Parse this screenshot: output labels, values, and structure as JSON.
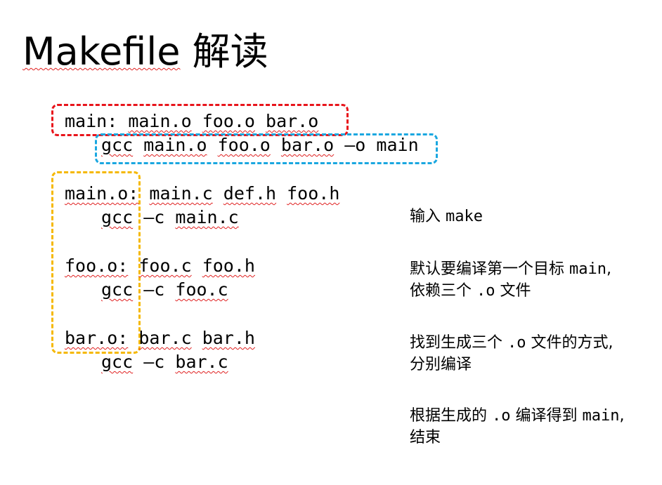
{
  "title": {
    "word": "Makefile",
    "suffix": " 解读"
  },
  "code": {
    "rule1_target": "main:",
    "rule1_deps": [
      "main.o",
      "foo.o",
      "bar.o"
    ],
    "rule1_cmd": [
      "gcc",
      "main.o",
      "foo.o",
      "bar.o",
      "–o",
      "main"
    ],
    "rule2_target": "main.o:",
    "rule2_deps": [
      "main.c",
      "def.h",
      "foo.h"
    ],
    "rule2_cmd": [
      "gcc",
      "–c",
      "main.c"
    ],
    "rule3_target": "foo.o:",
    "rule3_deps": [
      "foo.c",
      "foo.h"
    ],
    "rule3_cmd": [
      "gcc",
      "–c",
      "foo.c"
    ],
    "rule4_target": "bar.o:",
    "rule4_deps": [
      "bar.c",
      "bar.h"
    ],
    "rule4_cmd": [
      "gcc",
      "–c",
      "bar.c"
    ]
  },
  "highlight_colors": {
    "target_box": "#e8141b",
    "command_box": "#1aa7e0",
    "targets_column_box": "#f5b800"
  },
  "notes": {
    "n1_a": "输入 ",
    "n1_b": "make",
    "n2_line1_a": "默认要编译第一个目标 ",
    "n2_line1_b": "main",
    "n2_line1_c": ",",
    "n2_line2_a": "依赖三个 ",
    "n2_line2_b": ".o",
    "n2_line2_c": " 文件",
    "n3_line1_a": "找到生成三个 ",
    "n3_line1_b": ".o",
    "n3_line1_c": " 文件的方式,",
    "n3_line2": "分别编译",
    "n4_line1_a": "根据生成的 ",
    "n4_line1_b": ".o",
    "n4_line1_c": " 编译得到 ",
    "n4_line1_d": "main",
    "n4_line1_e": ",",
    "n4_line2": "结束"
  }
}
